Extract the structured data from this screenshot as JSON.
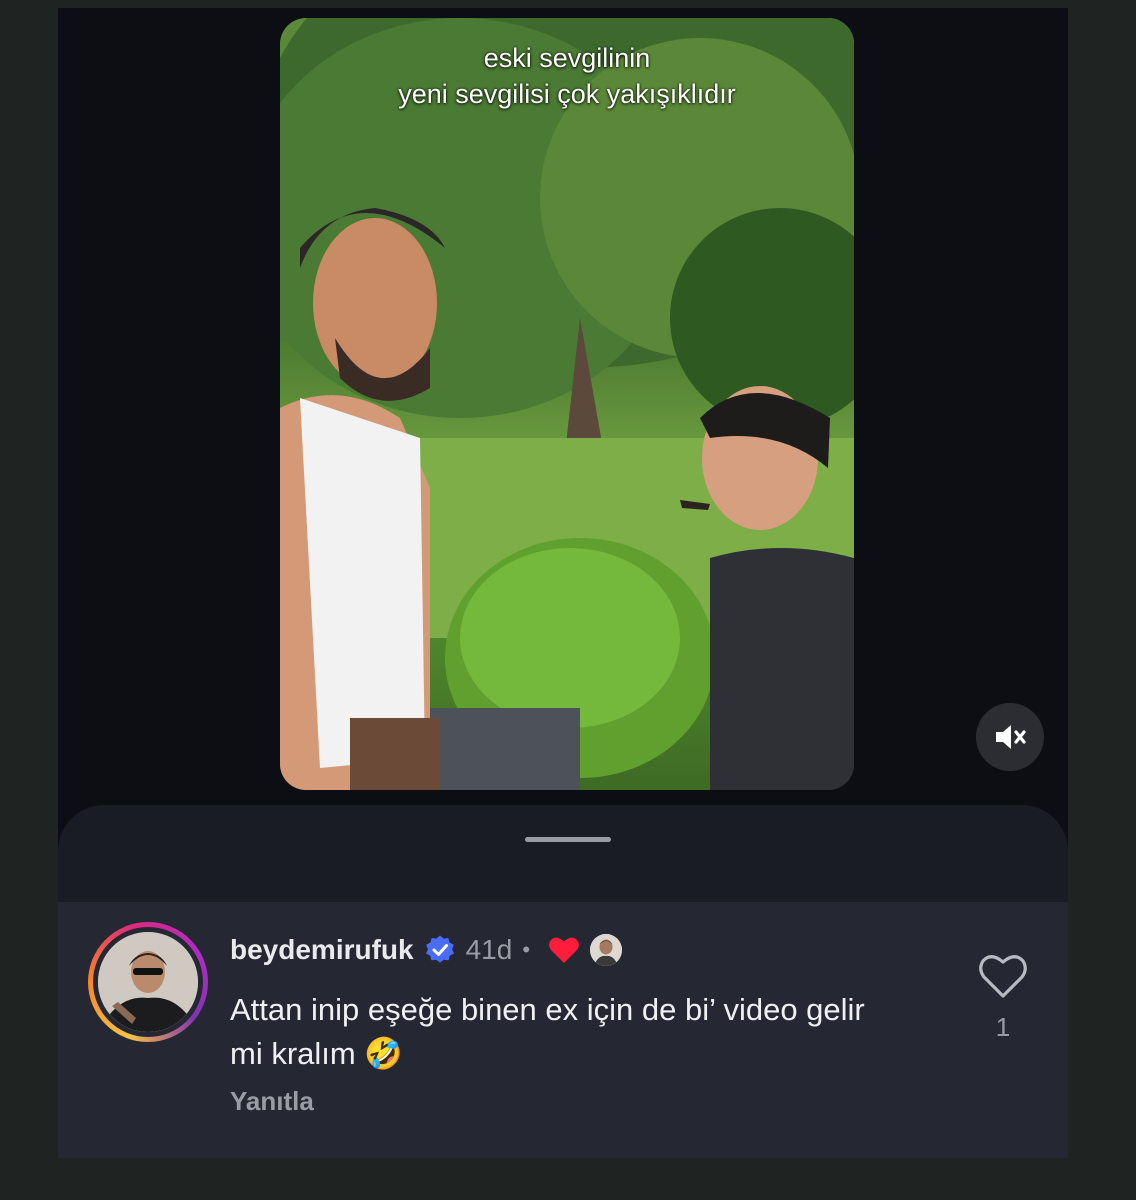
{
  "video": {
    "caption_line1": "eski sevgilinin",
    "caption_line2": "yeni sevgilisi çok yakışıklıdır",
    "mute_icon": "speaker-muted-icon"
  },
  "comment": {
    "username": "beydemirufuk",
    "verified": true,
    "time": "41d",
    "separator": "•",
    "creator_liked": true,
    "text": "Attan inip eşeğe binen ex için de bi’ video gelir mi kralım",
    "emoji": "🤣",
    "reply_label": "Yanıtla",
    "like_count": "1"
  },
  "colors": {
    "background": "#0d0e14",
    "sheet": "#1a1c23",
    "comment_bg": "#252833",
    "verified_blue": "#4a6cf7",
    "heart_red": "#ff1d3c",
    "muted_text": "#9a9ca5"
  }
}
